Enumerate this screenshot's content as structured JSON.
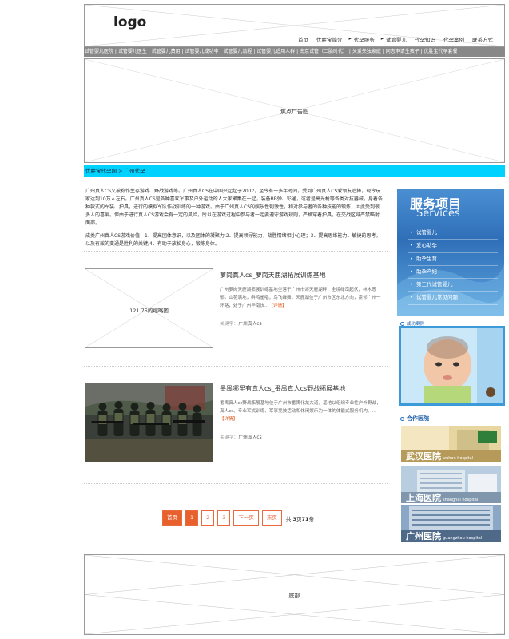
{
  "header": {
    "logo": "logo",
    "nav": [
      {
        "label": "首页",
        "arrow": false
      },
      {
        "label": "优胜宝简介",
        "arrow": false
      },
      {
        "label": "代孕服务",
        "arrow": true
      },
      {
        "label": "试管婴儿",
        "arrow": true
      },
      {
        "label": "代孕知识",
        "arrow": false
      },
      {
        "label": "代孕案例",
        "arrow": false
      },
      {
        "label": "联系方式",
        "arrow": false
      }
    ]
  },
  "catbar": "试管婴儿医院 | 试管婴儿医生 | 试管婴儿费用 | 试管婴儿成功率 | 试管婴儿流程 | 试管婴儿适用人群 | 南京试管（二胎时代） | 关爱失独家庭 | 同志申请生孩子 | 优胜宝代孕套餐",
  "banner": {
    "label": "焦点广告图"
  },
  "breadcrumb": "优胜宝代孕网 > 广州代孕",
  "intro": {
    "p1": "广州真人CS又被称作生存游戏、野战游戏等。广州真人CS在中国兴起起于2002，至今有十多年时间，受到广州真人CS爱领友追捧，现今玩家达到10万人左右。广州真人CS是各种喜欢军事及户外运动的人大家聚集在一起，装备BB弹、彩通，或者是高光枪等各类对抗器械，身着各种款式的军装、护具，进行的模拟军队作战训练的一种游戏。由于广州真人CS的娱乐性刺激性，和对参与者的各种技能的锻炼，因此受到很多人的喜爱。但由于进行真人CS游戏会有一定的风险，所以在游戏过程中参与者一定要遵守游戏规则，严格穿着护具，在交战区域严禁瞄射面部。",
    "p2": "成类广州真人CS游戏价值：1、提高团体意识，以及团体的凝聚力;2、提高领导能力，战胜情绪相小心理；3、提高思维能力，敏捷的思考，以及有效的变通是胜利的关键;4、有助于放松身心，锻炼身体。"
  },
  "articles": [
    {
      "thumb_label": "121.75的缩略图",
      "title": "萝岗真人cs_萝岗天鹿湖拓展训练基地",
      "desc": "广州萝岗天鹿湖拓展训练基地坐落于广州市郊天鹿湖畔，全境绿峦起伏，林木葱郁，山花满地，鲜鸣雀唱，鸟飞蝉舞，天鹿湖位于广州市区东北方向，紧邻广州一环路，处于广州华南快...",
      "more": "【详情】",
      "kw_label": "关键字：",
      "kw": "广州真人cs"
    },
    {
      "title": "番禺哪里有真人cs_番禺真人cs野战拓展基地",
      "desc": "番禺真人cs野战拓展基地位于广州市番禺化龙大道，基地以组织专业性户外野战，真人cs、专业军式训练、军事竞技活动和休闲娱乐为一体的体能式服务机构。...",
      "more": "【详情】",
      "kw_label": "关键字：",
      "kw": "广州真人cs"
    }
  ],
  "pager": {
    "first": "首页",
    "pages": [
      "1",
      "2",
      "3"
    ],
    "current": "1",
    "next": "下一页",
    "last": "末页",
    "info_prefix": "共",
    "info_pages": "3",
    "info_mid": "页",
    "info_count": "71",
    "info_suffix": "条"
  },
  "sidebar": {
    "services_title": "服务项目",
    "services_sub": "Services",
    "services": [
      "试管婴儿",
      "爱心助孕",
      "助孕生育",
      "助孕产妇",
      "第三代试管婴儿",
      "试管婴儿常见问题"
    ],
    "case_head": "成功案例",
    "hosp_head": "合作医院",
    "hospitals": [
      {
        "cn": "武汉医院",
        "en": "wuhan hospital"
      },
      {
        "cn": "上海医院",
        "en": "shanghai hospital"
      },
      {
        "cn": "广州医院",
        "en": "guangzhou hospital"
      }
    ]
  },
  "footer": {
    "label": "底部"
  }
}
